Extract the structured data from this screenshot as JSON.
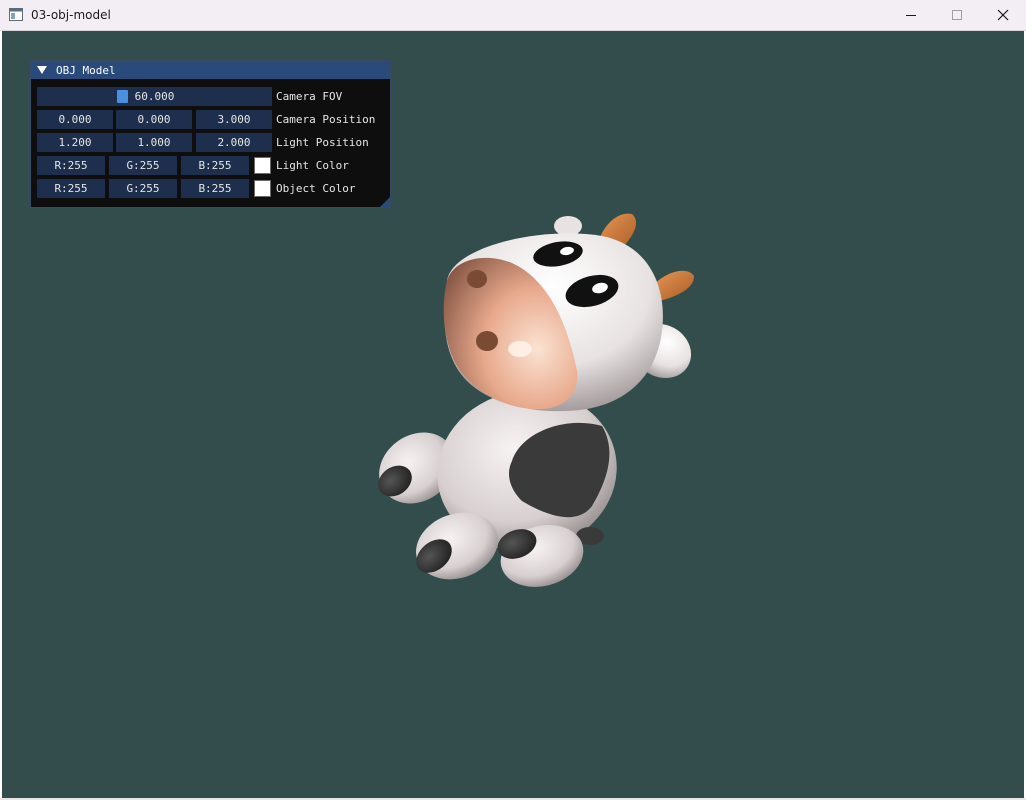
{
  "window": {
    "title": "03-obj-model",
    "icon": "app-window-icon",
    "controls": [
      "minimize-icon",
      "maximize-icon",
      "close-icon"
    ]
  },
  "viewport": {
    "background": "#334d4d",
    "content": "cow-model-render"
  },
  "panel": {
    "title": "OBJ Model",
    "header_color": "#294a7a",
    "field_color": "#1d2f4c",
    "slider_grab_color": "#4a90e0",
    "camera_fov": {
      "label": "Camera FOV",
      "value": "60.000"
    },
    "camera_position": {
      "label": "Camera Position",
      "x": "0.000",
      "y": "0.000",
      "z": "3.000"
    },
    "light_position": {
      "label": "Light Position",
      "x": "1.200",
      "y": "1.000",
      "z": "2.000"
    },
    "light_color": {
      "label": "Light Color",
      "r": "R:255",
      "g": "G:255",
      "b": "B:255",
      "swatch": "#ffffff"
    },
    "object_color": {
      "label": "Object Color",
      "r": "R:255",
      "g": "G:255",
      "b": "B:255",
      "swatch": "#ffffff"
    }
  }
}
